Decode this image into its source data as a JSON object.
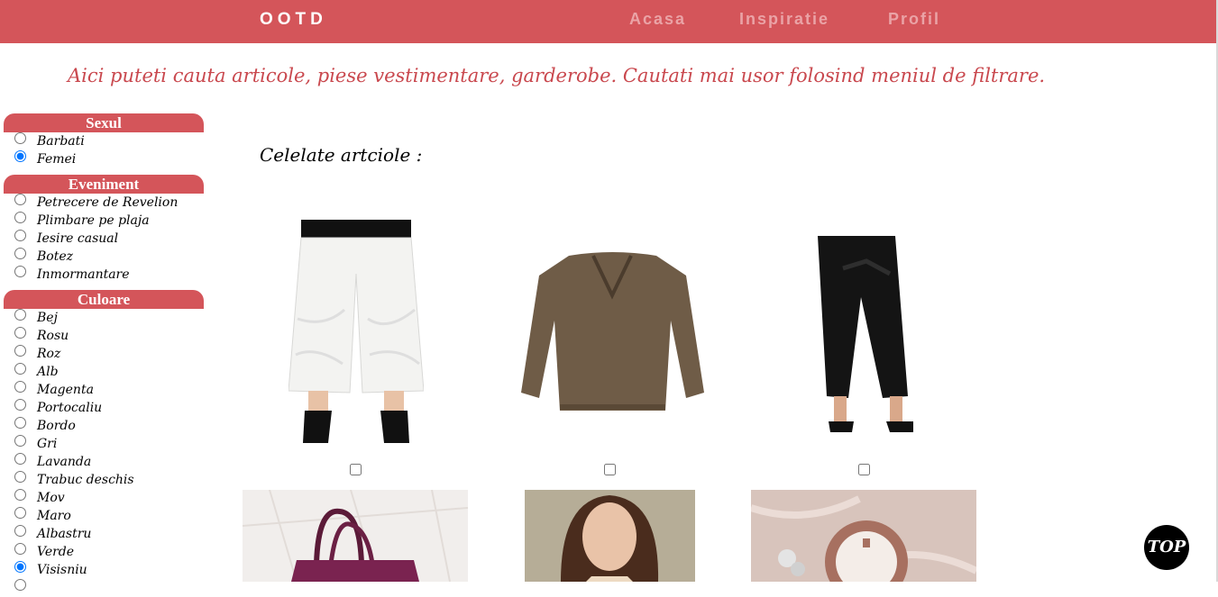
{
  "header": {
    "brand": "OOTD",
    "nav": [
      {
        "label": "Acasa"
      },
      {
        "label": "Inspiratie"
      },
      {
        "label": "Profil"
      }
    ]
  },
  "intro_text": "Aici puteti cauta articole, piese vestimentare, garderobe. Cautati mai usor folosind meniul de filtrare.",
  "filters": [
    {
      "title": "Sexul",
      "options": [
        {
          "label": "Barbati",
          "checked": false
        },
        {
          "label": "Femei",
          "checked": true
        }
      ]
    },
    {
      "title": "Eveniment",
      "options": [
        {
          "label": "Petrecere de Revelion",
          "checked": false
        },
        {
          "label": "Plimbare pe plaja",
          "checked": false
        },
        {
          "label": "Iesire casual",
          "checked": false
        },
        {
          "label": "Botez",
          "checked": false
        },
        {
          "label": "Inmormantare",
          "checked": false
        }
      ]
    },
    {
      "title": "Culoare",
      "options": [
        {
          "label": "Bej",
          "checked": false
        },
        {
          "label": "Rosu",
          "checked": false
        },
        {
          "label": "Roz",
          "checked": false
        },
        {
          "label": "Alb",
          "checked": false
        },
        {
          "label": "Magenta",
          "checked": false
        },
        {
          "label": "Portocaliu",
          "checked": false
        },
        {
          "label": "Bordo",
          "checked": false
        },
        {
          "label": "Gri",
          "checked": false
        },
        {
          "label": "Lavanda",
          "checked": false
        },
        {
          "label": "Trabuc deschis",
          "checked": false
        },
        {
          "label": "Mov",
          "checked": false
        },
        {
          "label": "Maro",
          "checked": false
        },
        {
          "label": "Albastru",
          "checked": false
        },
        {
          "label": "Verde",
          "checked": false
        },
        {
          "label": "Visisniu",
          "checked": true
        }
      ]
    }
  ],
  "main": {
    "heading": "Celelate artciole :"
  },
  "scroll_top_label": "TOP",
  "colors": {
    "accent": "#d4555a",
    "intro_text": "#c9484e",
    "nav_link": "#eaa3a6"
  }
}
